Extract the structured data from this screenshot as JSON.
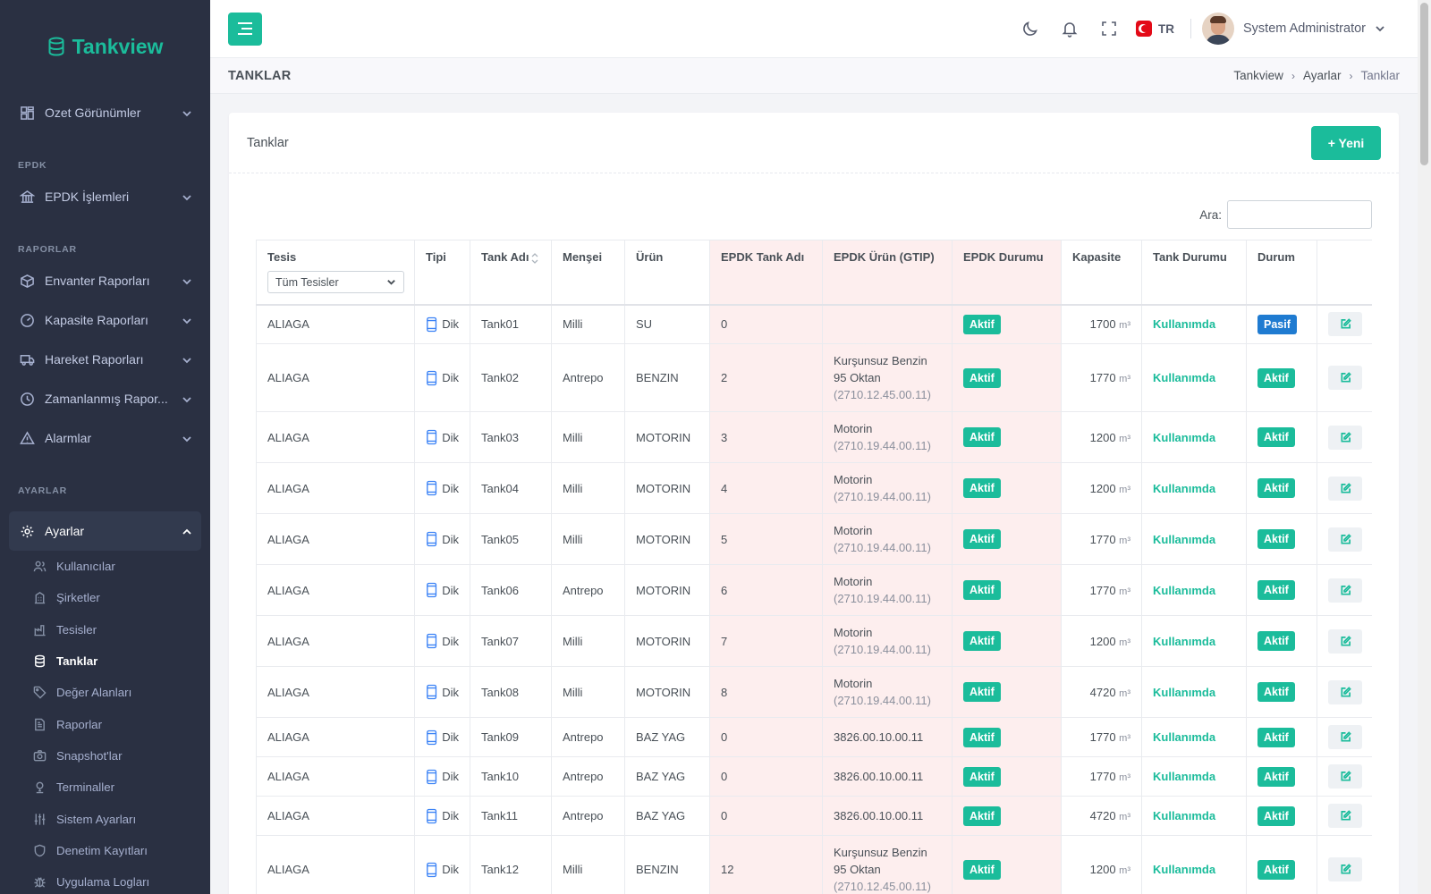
{
  "app": {
    "name": "Tankview"
  },
  "sidebar": {
    "top_items": [
      {
        "label": "Ozet Görünümler",
        "icon": "dashboard-icon"
      }
    ],
    "sections": [
      {
        "title": "EPDK",
        "items": [
          {
            "label": "EPDK İşlemleri",
            "icon": "bank-icon"
          }
        ]
      },
      {
        "title": "RAPORLAR",
        "items": [
          {
            "label": "Envanter Raporları",
            "icon": "box-icon"
          },
          {
            "label": "Kapasite Raporları",
            "icon": "gauge-icon"
          },
          {
            "label": "Hareket Raporları",
            "icon": "truck-icon"
          },
          {
            "label": "Zamanlanmış Rapor...",
            "icon": "clock-icon"
          },
          {
            "label": "Alarmlar",
            "icon": "warning-icon"
          }
        ]
      },
      {
        "title": "AYARLAR",
        "items": [
          {
            "label": "Ayarlar",
            "icon": "settings-icon"
          }
        ]
      }
    ],
    "submenu": [
      {
        "label": "Kullanıcılar",
        "icon": "users-icon"
      },
      {
        "label": "Şirketler",
        "icon": "building-icon"
      },
      {
        "label": "Tesisler",
        "icon": "factory-icon"
      },
      {
        "label": "Tanklar",
        "icon": "database-icon",
        "current": true
      },
      {
        "label": "Değer Alanları",
        "icon": "tag-icon"
      },
      {
        "label": "Raporlar",
        "icon": "report-icon"
      },
      {
        "label": "Snapshot'lar",
        "icon": "camera-icon"
      },
      {
        "label": "Terminaller",
        "icon": "terminal-icon"
      },
      {
        "label": "Sistem Ayarları",
        "icon": "sliders-icon"
      },
      {
        "label": "Denetim Kayıtları",
        "icon": "shield-icon"
      },
      {
        "label": "Uygulama Logları",
        "icon": "bug-icon"
      }
    ]
  },
  "topbar": {
    "language": "TR",
    "user_name": "System Administrator"
  },
  "page": {
    "title": "TANKLAR",
    "breadcrumb": [
      "Tankview",
      "Ayarlar",
      "Tanklar"
    ]
  },
  "card": {
    "title": "Tanklar",
    "new_button": "+ Yeni",
    "search_label": "Ara:",
    "search_value": ""
  },
  "table": {
    "columns": {
      "tesis": "Tesis",
      "tipi": "Tipi",
      "tank_adi": "Tank Adı",
      "mensei": "Menşei",
      "urun": "Ürün",
      "epdk_tank_adi": "EPDK Tank Adı",
      "epdk_urun": "EPDK Ürün (GTIP)",
      "epdk_durumu": "EPDK Durumu",
      "kapasite": "Kapasite",
      "tank_durumu": "Tank Durumu",
      "durum": "Durum"
    },
    "tesis_filter": "Tüm Tesisler",
    "capacity_unit": "m³",
    "rows": [
      {
        "tesis": "ALIAGA",
        "tipi": "Dik",
        "tank": "Tank01",
        "mensei": "Milli",
        "urun": "SU",
        "epdk_tank": "0",
        "gtip_name": "",
        "gtip_code": "",
        "epdk_durumu": "Aktif",
        "kapasite": "1700",
        "tank_durumu": "Kullanımda",
        "durum": "Pasif",
        "durum_color": "blue"
      },
      {
        "tesis": "ALIAGA",
        "tipi": "Dik",
        "tank": "Tank02",
        "mensei": "Antrepo",
        "urun": "BENZIN",
        "epdk_tank": "2",
        "gtip_name": "Kurşunsuz Benzin 95 Oktan",
        "gtip_code": "(2710.12.45.00.11)",
        "epdk_durumu": "Aktif",
        "kapasite": "1770",
        "tank_durumu": "Kullanımda",
        "durum": "Aktif",
        "durum_color": "green"
      },
      {
        "tesis": "ALIAGA",
        "tipi": "Dik",
        "tank": "Tank03",
        "mensei": "Milli",
        "urun": "MOTORIN",
        "epdk_tank": "3",
        "gtip_name": "Motorin",
        "gtip_code": "(2710.19.44.00.11)",
        "epdk_durumu": "Aktif",
        "kapasite": "1200",
        "tank_durumu": "Kullanımda",
        "durum": "Aktif",
        "durum_color": "green"
      },
      {
        "tesis": "ALIAGA",
        "tipi": "Dik",
        "tank": "Tank04",
        "mensei": "Milli",
        "urun": "MOTORIN",
        "epdk_tank": "4",
        "gtip_name": "Motorin",
        "gtip_code": "(2710.19.44.00.11)",
        "epdk_durumu": "Aktif",
        "kapasite": "1200",
        "tank_durumu": "Kullanımda",
        "durum": "Aktif",
        "durum_color": "green"
      },
      {
        "tesis": "ALIAGA",
        "tipi": "Dik",
        "tank": "Tank05",
        "mensei": "Milli",
        "urun": "MOTORIN",
        "epdk_tank": "5",
        "gtip_name": "Motorin",
        "gtip_code": "(2710.19.44.00.11)",
        "epdk_durumu": "Aktif",
        "kapasite": "1770",
        "tank_durumu": "Kullanımda",
        "durum": "Aktif",
        "durum_color": "green"
      },
      {
        "tesis": "ALIAGA",
        "tipi": "Dik",
        "tank": "Tank06",
        "mensei": "Antrepo",
        "urun": "MOTORIN",
        "epdk_tank": "6",
        "gtip_name": "Motorin",
        "gtip_code": "(2710.19.44.00.11)",
        "epdk_durumu": "Aktif",
        "kapasite": "1770",
        "tank_durumu": "Kullanımda",
        "durum": "Aktif",
        "durum_color": "green"
      },
      {
        "tesis": "ALIAGA",
        "tipi": "Dik",
        "tank": "Tank07",
        "mensei": "Milli",
        "urun": "MOTORIN",
        "epdk_tank": "7",
        "gtip_name": "Motorin",
        "gtip_code": "(2710.19.44.00.11)",
        "epdk_durumu": "Aktif",
        "kapasite": "1200",
        "tank_durumu": "Kullanımda",
        "durum": "Aktif",
        "durum_color": "green"
      },
      {
        "tesis": "ALIAGA",
        "tipi": "Dik",
        "tank": "Tank08",
        "mensei": "Milli",
        "urun": "MOTORIN",
        "epdk_tank": "8",
        "gtip_name": "Motorin",
        "gtip_code": "(2710.19.44.00.11)",
        "epdk_durumu": "Aktif",
        "kapasite": "4720",
        "tank_durumu": "Kullanımda",
        "durum": "Aktif",
        "durum_color": "green"
      },
      {
        "tesis": "ALIAGA",
        "tipi": "Dik",
        "tank": "Tank09",
        "mensei": "Antrepo",
        "urun": "BAZ YAG",
        "epdk_tank": "0",
        "gtip_name": "3826.00.10.00.11",
        "gtip_code": "",
        "epdk_durumu": "Aktif",
        "kapasite": "1770",
        "tank_durumu": "Kullanımda",
        "durum": "Aktif",
        "durum_color": "green"
      },
      {
        "tesis": "ALIAGA",
        "tipi": "Dik",
        "tank": "Tank10",
        "mensei": "Antrepo",
        "urun": "BAZ YAG",
        "epdk_tank": "0",
        "gtip_name": "3826.00.10.00.11",
        "gtip_code": "",
        "epdk_durumu": "Aktif",
        "kapasite": "1770",
        "tank_durumu": "Kullanımda",
        "durum": "Aktif",
        "durum_color": "green"
      },
      {
        "tesis": "ALIAGA",
        "tipi": "Dik",
        "tank": "Tank11",
        "mensei": "Antrepo",
        "urun": "BAZ YAG",
        "epdk_tank": "0",
        "gtip_name": "3826.00.10.00.11",
        "gtip_code": "",
        "epdk_durumu": "Aktif",
        "kapasite": "4720",
        "tank_durumu": "Kullanımda",
        "durum": "Aktif",
        "durum_color": "green"
      },
      {
        "tesis": "ALIAGA",
        "tipi": "Dik",
        "tank": "Tank12",
        "mensei": "Milli",
        "urun": "BENZIN",
        "epdk_tank": "12",
        "gtip_name": "Kurşunsuz Benzin 95 Oktan",
        "gtip_code": "(2710.12.45.00.11)",
        "epdk_durumu": "Aktif",
        "kapasite": "1200",
        "tank_durumu": "Kullanımda",
        "durum": "Aktif",
        "durum_color": "green"
      }
    ]
  },
  "colors": {
    "accent": "#1bbc9b",
    "sidebar": "#2a3042",
    "pasif": "#1f7bd1",
    "epdk_bg": "#fdeeee"
  }
}
